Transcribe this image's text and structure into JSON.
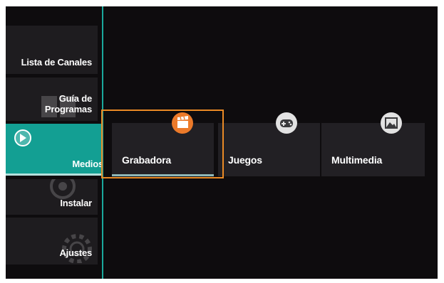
{
  "sidebar": {
    "items": [
      {
        "label": "Lista de Canales",
        "icon": "channel-list-icon"
      },
      {
        "label": "Guía de\nProgramas",
        "icon": "program-guide-icon"
      },
      {
        "label": "Medios",
        "icon": "play-icon",
        "active": true
      },
      {
        "label": "Instalar",
        "icon": "satellite-dish-icon"
      },
      {
        "label": "Ajustes",
        "icon": "gear-icon"
      }
    ]
  },
  "media": {
    "tiles": [
      {
        "label": "Grabadora",
        "icon": "clapperboard-icon",
        "focused": true
      },
      {
        "label": "Juegos",
        "icon": "gamepad-icon"
      },
      {
        "label": "Multimedia",
        "icon": "picture-icon"
      }
    ]
  },
  "colors": {
    "accent": "#139f93",
    "focus": "#ea8a25",
    "recorder_icon": "#ec7a2a",
    "background": "#0e0c0e"
  }
}
